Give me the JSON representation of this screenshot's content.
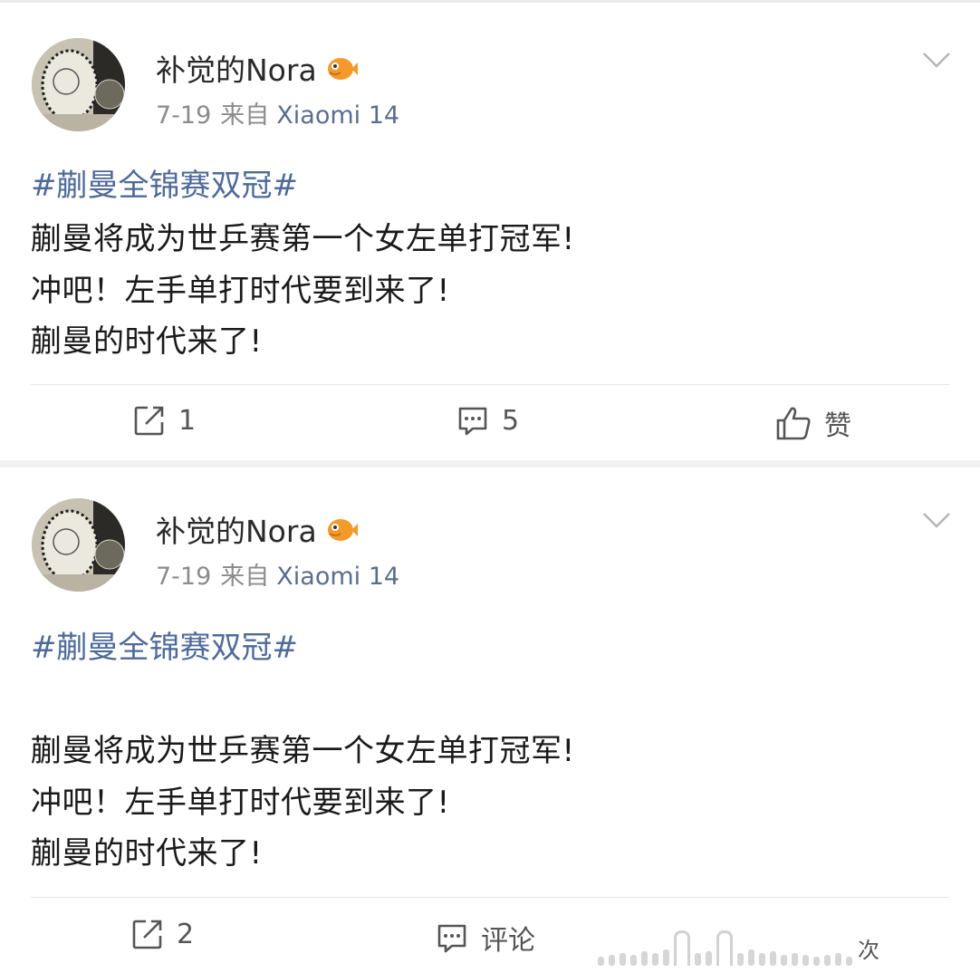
{
  "posts": [
    {
      "username": "补觉的Nora",
      "date": "7-19",
      "from_label": "来自",
      "device": "Xiaomi 14",
      "hashtag": "#蒯曼全锦赛双冠#",
      "lines": [
        "蒯曼将成为世乒赛第一个女左单打冠军!",
        "冲吧！左手单打时代要到来了!",
        "蒯曼的时代来了!"
      ],
      "actions": {
        "repost": "1",
        "comment": "5",
        "like": "赞"
      }
    },
    {
      "username": "补觉的Nora",
      "date": "7-19",
      "from_label": "来自",
      "device": "Xiaomi 14",
      "hashtag": "#蒯曼全锦赛双冠#",
      "lines": [
        "蒯曼将成为世乒赛第一个女左单打冠军!",
        "冲吧！左手单打时代要到来了!",
        "蒯曼的时代来了!"
      ],
      "actions": {
        "repost": "2",
        "comment": "评论",
        "like": ""
      }
    }
  ],
  "watermark": {
    "text": "次"
  },
  "colors": {
    "link": "#4e6a98",
    "device": "#5b6d8e",
    "meta": "#8c8c8c",
    "divider": "#e6e6e6"
  },
  "icons": [
    "avatar-image",
    "fish-badge-icon",
    "chevron-down-icon",
    "repost-icon",
    "comment-icon",
    "like-icon"
  ]
}
